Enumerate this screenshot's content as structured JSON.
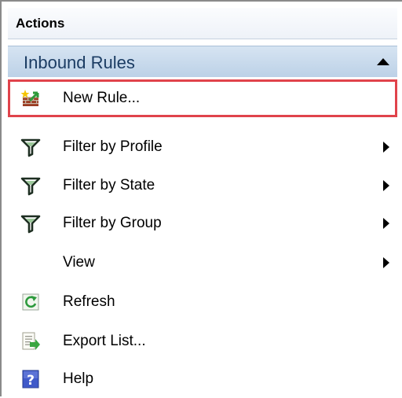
{
  "pane": {
    "title": "Actions"
  },
  "section": {
    "title": "Inbound Rules",
    "collapse_icon": "triangle-up-icon"
  },
  "menu": {
    "items": [
      {
        "label": "New Rule...",
        "icon": "new-rule-firewall-icon",
        "selected": true,
        "has_submenu": false
      },
      {
        "label": "Filter by Profile",
        "icon": "filter-funnel-icon",
        "selected": false,
        "has_submenu": true
      },
      {
        "label": "Filter by State",
        "icon": "filter-funnel-icon",
        "selected": false,
        "has_submenu": true
      },
      {
        "label": "Filter by Group",
        "icon": "filter-funnel-icon",
        "selected": false,
        "has_submenu": true
      },
      {
        "label": "View",
        "icon": "",
        "selected": false,
        "has_submenu": true
      },
      {
        "label": "Refresh",
        "icon": "refresh-icon",
        "selected": false,
        "has_submenu": false
      },
      {
        "label": "Export List...",
        "icon": "export-list-icon",
        "selected": false,
        "has_submenu": false
      },
      {
        "label": "Help",
        "icon": "help-icon",
        "selected": false,
        "has_submenu": false
      }
    ]
  },
  "colors": {
    "selection_outline": "#e0434b",
    "section_header_text": "#1b3c63",
    "section_header_bg": "#bcd1e7"
  }
}
